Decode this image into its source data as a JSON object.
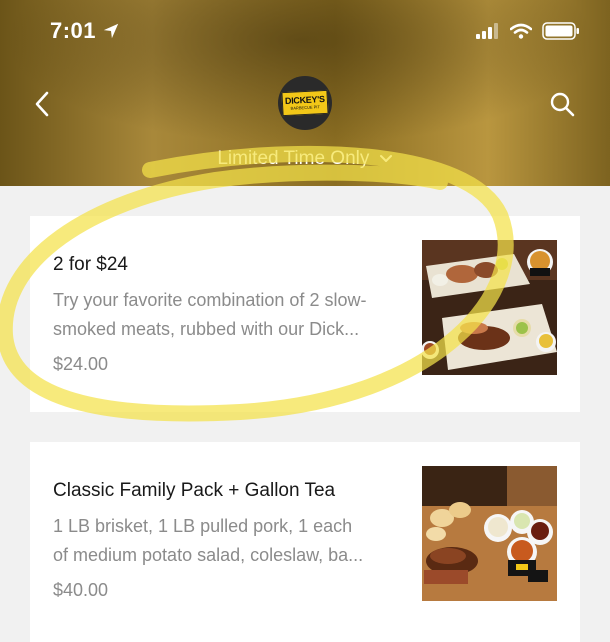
{
  "status_bar": {
    "time": "7:01"
  },
  "header": {
    "logo_line1": "DICKEY'S",
    "logo_line2": "BARBECUE PIT",
    "menu_title": "Limited Time Only"
  },
  "items": [
    {
      "name": "2 for $24",
      "description": "Try your favorite combination of 2 slow-smoked meats, rubbed with our Dick...",
      "desc_line1": "Try your favorite combination of 2 slow-",
      "desc_line2": "smoked meats, rubbed with our Dick...",
      "price": "$24.00"
    },
    {
      "name": "Classic Family Pack + Gallon Tea",
      "desc_line1": "1 LB brisket, 1 LB pulled pork, 1 each",
      "desc_line2": "of medium potato salad, coleslaw, ba...",
      "price": "$40.00"
    }
  ],
  "colors": {
    "highlight": "#f4e24a",
    "brand_yellow": "#f2c718"
  }
}
